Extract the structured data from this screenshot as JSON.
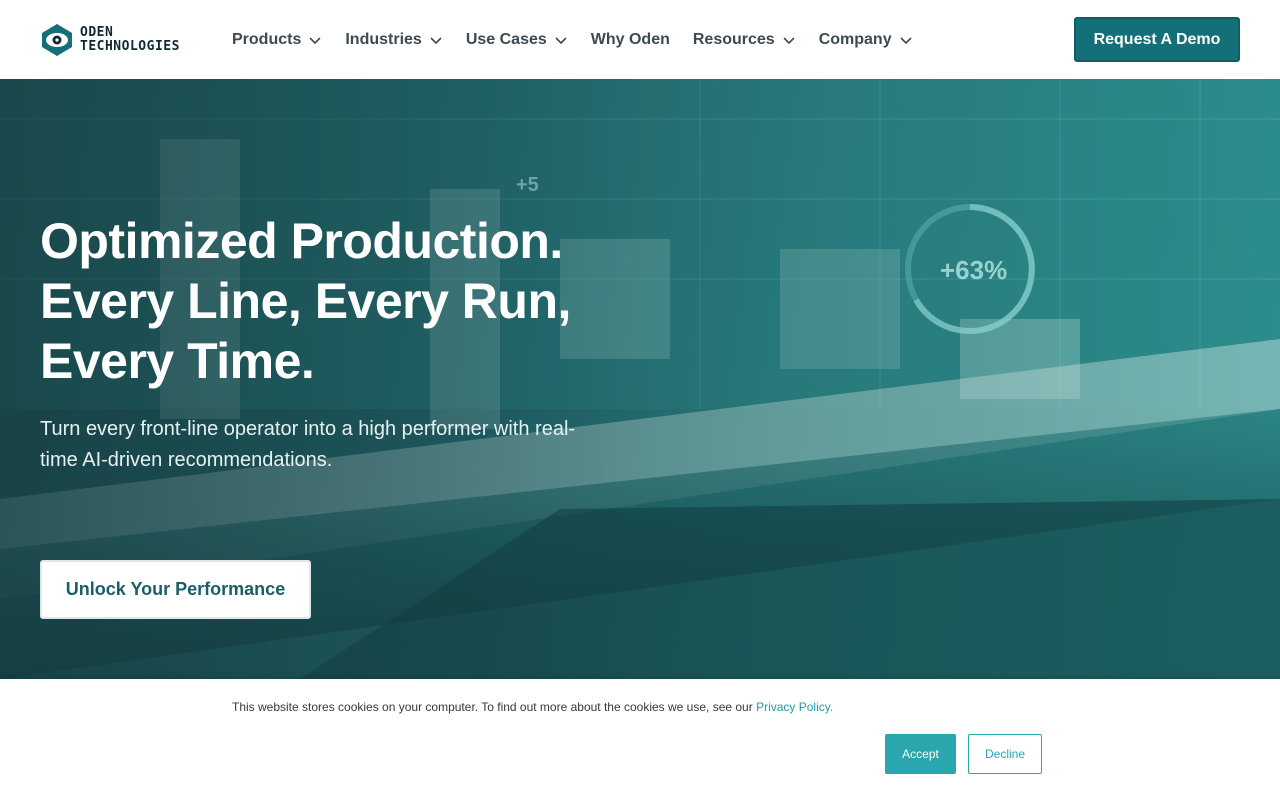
{
  "brand": {
    "logo_line1": "ODEN",
    "logo_line2": "TECHNOLOGIES",
    "primary_color": "#136f78",
    "accent_color": "#2aa7ad"
  },
  "nav": {
    "items": [
      {
        "label": "Products",
        "has_dropdown": true
      },
      {
        "label": "Industries",
        "has_dropdown": true
      },
      {
        "label": "Use Cases",
        "has_dropdown": true
      },
      {
        "label": "Why Oden",
        "has_dropdown": false
      },
      {
        "label": "Resources",
        "has_dropdown": true
      },
      {
        "label": "Company",
        "has_dropdown": true
      }
    ],
    "demo_label": "Request A Demo"
  },
  "hero": {
    "title_lines": [
      "Optimized Production.",
      "Every Line, Every Run,",
      "Every Time."
    ],
    "subtitle": "Turn every front-line operator into a high performer with real-time AI-driven recommendations.",
    "cta_label": "Unlock Your Performance",
    "overlay_readouts": [
      "+63%",
      "+5"
    ]
  },
  "cookie_banner": {
    "text": "This website stores cookies on your computer. To find out more about the cookies we use, see our ",
    "link_text": "Privacy Policy.",
    "accept_label": "Accept",
    "decline_label": "Decline"
  }
}
